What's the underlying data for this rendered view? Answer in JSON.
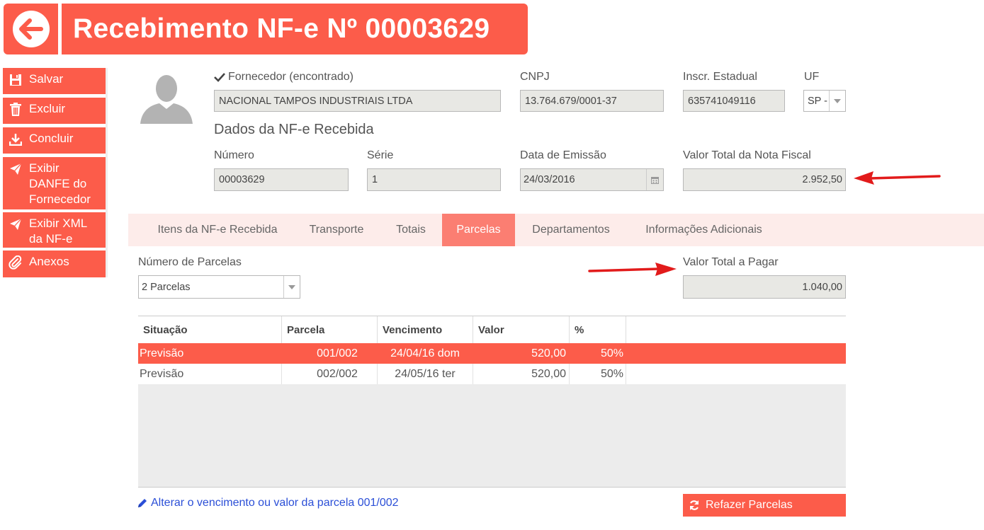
{
  "header": {
    "title": "Recebimento NF-e Nº 00003629",
    "back_icon": "arrow-left-icon"
  },
  "sidebar": {
    "items": [
      {
        "label": "Salvar",
        "icon": "floppy-disk-icon"
      },
      {
        "label": "Excluir",
        "icon": "trash-icon"
      },
      {
        "label": "Concluir",
        "icon": "download-icon"
      },
      {
        "label": "Exibir DANFE do Fornecedor",
        "icon": "paper-plane-icon"
      },
      {
        "label": "Exibir XML da NF-e",
        "icon": "paper-plane-icon"
      },
      {
        "label": "Anexos",
        "icon": "paperclip-icon"
      }
    ]
  },
  "supplier": {
    "label": "Fornecedor (encontrado)",
    "name": "NACIONAL TAMPOS INDUSTRIAIS LTDA",
    "cnpj_label": "CNPJ",
    "cnpj": "13.764.679/0001-37",
    "ie_label": "Inscr. Estadual",
    "ie": "635741049116",
    "uf_label": "UF",
    "uf": "SP -"
  },
  "nfe": {
    "section_title": "Dados da NF-e Recebida",
    "numero_label": "Número",
    "numero": "00003629",
    "serie_label": "Série",
    "serie": "1",
    "data_label": "Data de Emissão",
    "data": "24/03/2016",
    "valor_label": "Valor Total da Nota Fiscal",
    "valor": "2.952,50"
  },
  "tabs": [
    {
      "label": "Itens da NF-e Recebida"
    },
    {
      "label": "Transporte"
    },
    {
      "label": "Totais"
    },
    {
      "label": "Parcelas",
      "active": true
    },
    {
      "label": "Departamentos"
    },
    {
      "label": "Informações Adicionais"
    }
  ],
  "parcelas": {
    "num_label": "Número de Parcelas",
    "num_value": "2 Parcelas",
    "total_label": "Valor Total a Pagar",
    "total_value": "1.040,00"
  },
  "table": {
    "headers": [
      "Situação",
      "Parcela",
      "Vencimento",
      "Valor",
      "%"
    ],
    "rows": [
      {
        "situacao": "Previsão",
        "parcela": "001/002",
        "vencimento": "24/04/16 dom",
        "valor": "520,00",
        "pct": "50%",
        "selected": true
      },
      {
        "situacao": "Previsão",
        "parcela": "002/002",
        "vencimento": "24/05/16 ter",
        "valor": "520,00",
        "pct": "50%",
        "selected": false
      }
    ]
  },
  "footer": {
    "edit_link": "Alterar o vencimento ou valor da parcela 001/002",
    "redo_button": "Refazer Parcelas"
  },
  "colors": {
    "accent": "#fc5c4a",
    "tab_active": "#fb7e72",
    "tab_bar": "#fdecea",
    "arrow": "#e21b1b",
    "link": "#2b4fd7"
  }
}
